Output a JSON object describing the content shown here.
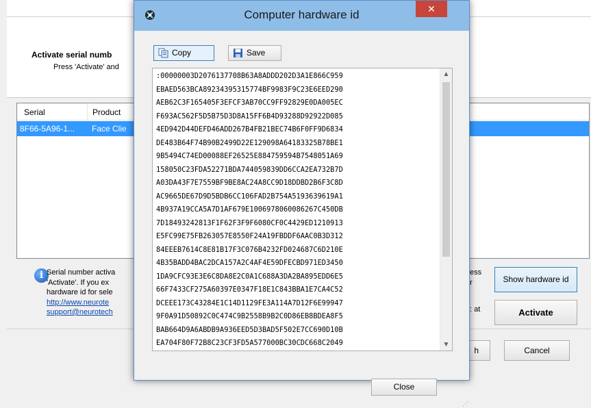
{
  "background_window": {
    "heading": "Activate serial numb",
    "subheading": "Press 'Activate' and",
    "table": {
      "columns": [
        "Serial",
        "Product"
      ],
      "rows": [
        {
          "serial": "8F66-5A96-1...",
          "product": "Face Clie"
        }
      ]
    },
    "info_lines": [
      "Serial number activa",
      "'Activate'.  If you ex",
      "hardware id for sele"
    ],
    "link_lines": [
      "http://www.neurote",
      "support@neurotech"
    ],
    "info_right_lines": [
      "ess",
      "r"
    ],
    "info_at": ": at",
    "buttons": {
      "show_hardware_id": "Show hardware id",
      "activate": "Activate",
      "next_partial": "h",
      "cancel": "Cancel"
    }
  },
  "dialog": {
    "title": "Computer hardware id",
    "close_glyph": "✕",
    "toolbar": {
      "copy_label": "Copy",
      "save_label": "Save"
    },
    "hardware_id_lines": [
      ":00000003D2076137708B63A8ADDD202D3A1E866C959",
      "EBAED563BCA89234395315774BF9983F9C23E6EED290",
      "AEB62C3F165405F3EFCF3AB70CC9FF92829E0DA005EC",
      "F693AC562F5D5B75D3D8A15FF6B4D93288D92922D085",
      "4ED942D44DEFD46ADD267B4FB21BEC74B6F0FF9D6834",
      "DE483B64F74B90B2499D22E129098A64183325B78BE1",
      "9B5494C74ED00088EF26525E884759594B7548051A69",
      "158050C23FDA52271BDA744059839DD6CCA2EA732B7D",
      "A03DA43F7E7559BF9BE8AC24A8CC9D18DDBD2B6F3C8D",
      "AC9665DE67D9D5BDB6CC106FAD2B754A5193639619A1",
      "4B937A19CCA5A7D1AF679E1006978060086267C450DB",
      "7D18493242813F1F62F3F9F6080CF0C4429ED1210913",
      "E5FC99E75FB263057E8550F24A19FBDDF6AAC0B3D312",
      "84EEEB7614C8E81B17F3C076B4232FD024687C6D210E",
      "4B35BADD4BAC2DCA157A2C4AF4E59DFECBD971ED3450",
      "1DA9CFC93E3E6C8DA8E2C0A1C688A3DA2BA895EDD6E5",
      "66F7433CF275A60397E0347F18E1C843BBA1E7CA4C52",
      "DCEEE173C43284E1C14D1129FE3A114A7D12F6E99947",
      "9F0A91D50892C0C474C9B2558B9B2C0D86EB8BDEA8F5",
      "BAB664D9A6ABDB9A936EED5D3BAD5F502E7CC690D10B",
      "EA704F80F72B8C23CF3FD5A577000BC30CDC668C2049"
    ],
    "close_button_label": "Close"
  },
  "colors": {
    "titlebar": "#8ebde8",
    "close_red": "#c7453a",
    "selection": "#3399ff",
    "link": "#0645ad"
  }
}
